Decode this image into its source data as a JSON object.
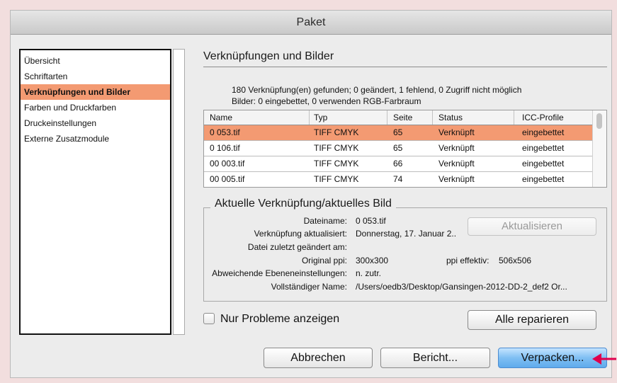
{
  "window": {
    "title": "Paket"
  },
  "sidebar": {
    "items": [
      {
        "label": "Übersicht"
      },
      {
        "label": "Schriftarten"
      },
      {
        "label": "Verknüpfungen und Bilder",
        "selected": true
      },
      {
        "label": "Farben und Druckfarben"
      },
      {
        "label": "Druckeinstellungen"
      },
      {
        "label": "Externe Zusatzmodule"
      }
    ]
  },
  "main": {
    "section_title": "Verknüpfungen und Bilder",
    "summary_line1": "180 Verknüpfung(en) gefunden; 0 geändert, 1 fehlend, 0 Zugriff nicht möglich",
    "summary_line2": "Bilder: 0 eingebettet, 0 verwenden RGB-Farbraum"
  },
  "links_table": {
    "columns": [
      "Name",
      "Typ",
      "Seite",
      "Status",
      "ICC-Profile"
    ],
    "rows": [
      [
        "0 053.tif",
        "TIFF CMYK",
        "65",
        "Verknüpft",
        "eingebettet"
      ],
      [
        "0 106.tif",
        "TIFF CMYK",
        "65",
        "Verknüpft",
        "eingebettet"
      ],
      [
        "00 003.tif",
        "TIFF CMYK",
        "66",
        "Verknüpft",
        "eingebettet"
      ],
      [
        "00 005.tif",
        "TIFF CMYK",
        "74",
        "Verknüpft",
        "eingebettet"
      ]
    ],
    "selected_row": 0
  },
  "current_link": {
    "group_title": "Aktuelle Verknüpfung/aktuelles Bild",
    "filename_label": "Dateiname:",
    "filename_value": "0 053.tif",
    "updated_label": "Verknüpfung aktualisiert:",
    "updated_value": "Donnerstag, 17. Januar 2..",
    "modified_label": "Datei zuletzt geändert am:",
    "modified_value": "",
    "original_ppi_label": "Original ppi:",
    "original_ppi_value": "300x300",
    "effective_ppi_label": "ppi effektiv:",
    "effective_ppi_value": "506x506",
    "layer_label": "Abweichende Ebeneneinstellungen:",
    "layer_value": "n. zutr.",
    "fullname_label": "Vollständiger Name:",
    "fullname_value": "/Users/oedb3/Desktop/Gansingen-2012-DD-2_def2 Or...",
    "update_button": "Aktualisieren"
  },
  "options": {
    "only_problems_label": "Nur Probleme anzeigen",
    "only_problems_checked": false,
    "repair_all_button": "Alle reparieren"
  },
  "footer": {
    "cancel_button": "Abbrechen",
    "report_button": "Bericht...",
    "package_button": "Verpacken..."
  },
  "colors": {
    "selection": "#f39a72",
    "default_button": "#6cb4f0",
    "annotation_arrow": "#e0004d",
    "background": "#f2dede"
  }
}
